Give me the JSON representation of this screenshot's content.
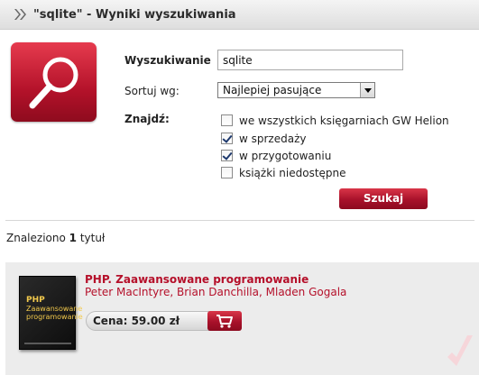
{
  "header": {
    "title": "\"sqlite\" - Wyniki wyszukiwania",
    "icon": "double-chevron-right-icon"
  },
  "search_form": {
    "logo_icon": "magnifier-icon",
    "query_label": "Wyszukiwanie",
    "query_value": "sqlite",
    "sort_label": "Sortuj wg:",
    "sort_value": "Najlepiej pasujące",
    "find_label": "Znajdź:",
    "options": [
      {
        "label": "we wszystkich księgarniach GW Helion",
        "checked": false
      },
      {
        "label": "w sprzedaży",
        "checked": true
      },
      {
        "label": "w przygotowaniu",
        "checked": true
      },
      {
        "label": "książki niedostępne",
        "checked": false
      }
    ],
    "submit_label": "Szukaj"
  },
  "results": {
    "found_prefix": "Znaleziono ",
    "found_count": "1",
    "found_suffix": " tytuł",
    "items": [
      {
        "title": "PHP. Zaawansowane programowanie",
        "authors": "Peter MacIntyre, Brian Danchilla, Mladen Gogala",
        "cover_title": "PHP",
        "cover_subtitle": "Zaawansowane programowanie",
        "price_label": "Cena: 59.00 zł",
        "cart_icon": "shopping-cart-icon"
      }
    ]
  },
  "colors": {
    "accent_red": "#b5102a",
    "panel_gray": "#ececec"
  }
}
